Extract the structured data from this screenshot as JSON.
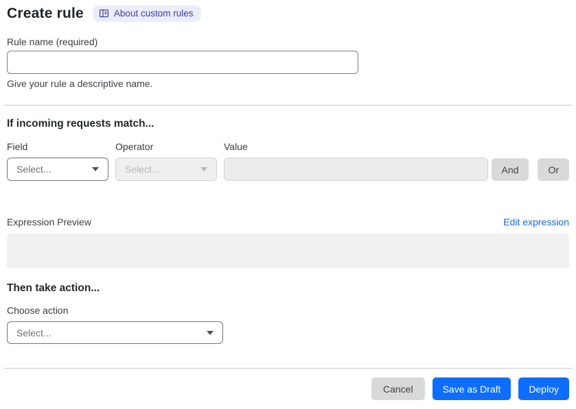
{
  "header": {
    "title": "Create rule",
    "about_link_label": "About custom rules"
  },
  "rule_name": {
    "label": "Rule name (required)",
    "value": "",
    "helper": "Give your rule a descriptive name."
  },
  "match_section": {
    "heading": "If incoming requests match...",
    "field": {
      "label": "Field",
      "selected": "Select..."
    },
    "operator": {
      "label": "Operator",
      "selected": "Select...",
      "disabled": true
    },
    "value": {
      "label": "Value",
      "value": "",
      "disabled": true
    },
    "and_button_label": "And",
    "or_button_label": "Or"
  },
  "expression": {
    "label": "Expression Preview",
    "edit_link_label": "Edit expression",
    "value": ""
  },
  "action_section": {
    "heading": "Then take action...",
    "choose_label": "Choose action",
    "selected": "Select..."
  },
  "footer": {
    "cancel_label": "Cancel",
    "save_draft_label": "Save as Draft",
    "deploy_label": "Deploy"
  },
  "icons": {
    "about_link": "book-icon",
    "selects": "chevron-down-icon"
  },
  "colors": {
    "primary_blue": "#0d6efd",
    "link_blue": "#1668e3",
    "badge_bg": "#ebedfa",
    "badge_text": "#3b3fa8",
    "disabled_bg": "#efefef",
    "button_gray": "#d9d9d9",
    "divider": "#c9c9c9",
    "preview_bg": "#f1f1f2"
  }
}
